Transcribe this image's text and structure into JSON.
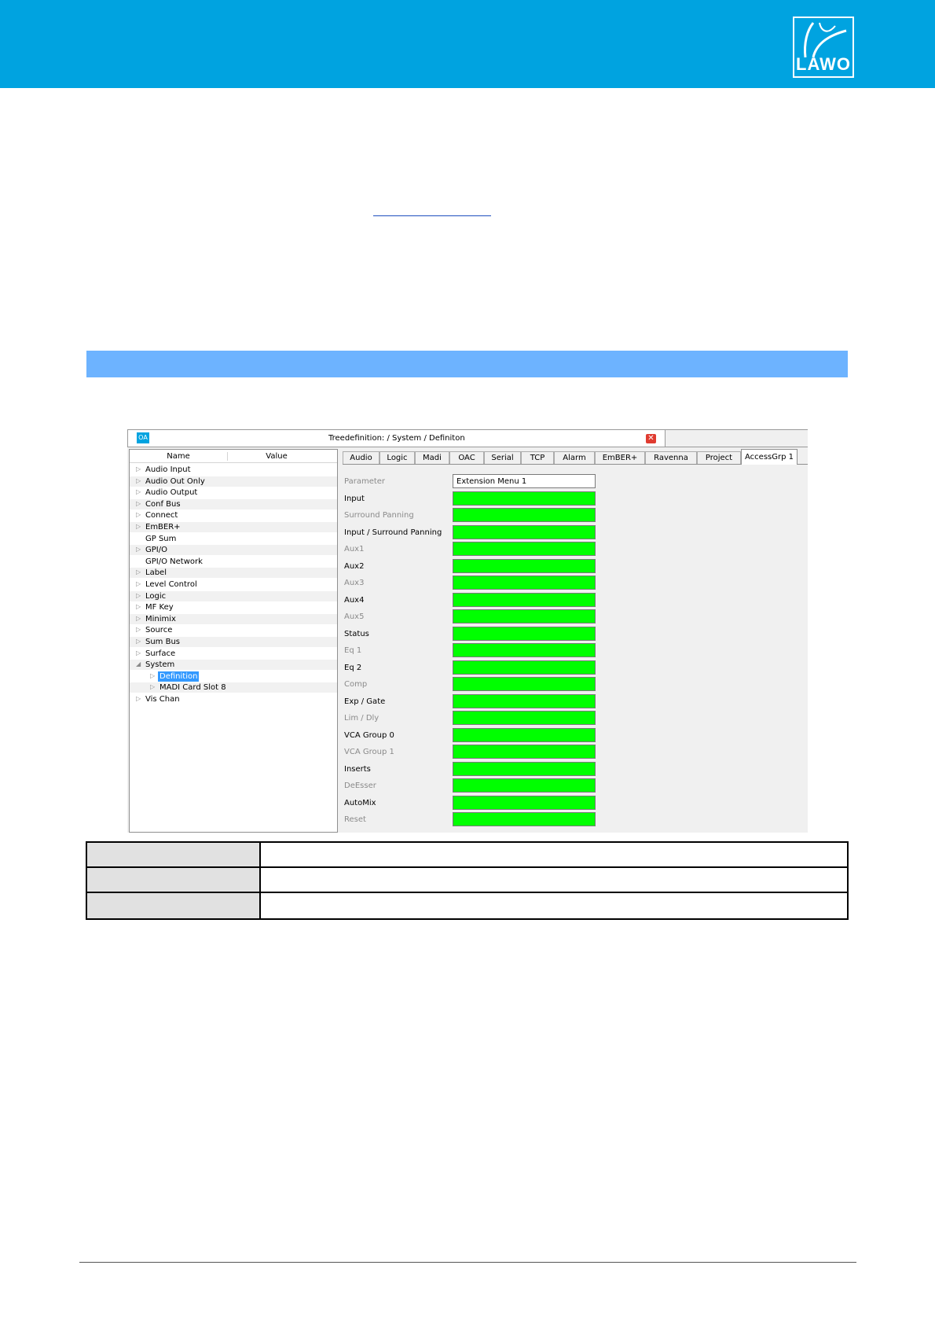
{
  "colors": {
    "header_blue": "#00a3e0",
    "section_bar": "#6db3ff",
    "selection": "#3399ff",
    "value_green": "#00ff00",
    "close_red": "#e03b30"
  },
  "header": {
    "logo_text": "LAWO"
  },
  "window": {
    "icon_label": "OA",
    "title": "Treedefinition:  / System / Definiton",
    "close_icon": "close-icon"
  },
  "tree": {
    "columns": [
      "Name",
      "Value"
    ],
    "items": [
      {
        "label": "Audio Input",
        "arrow": "▷",
        "indent": 0,
        "alt": false,
        "selected": false
      },
      {
        "label": "Audio Out Only",
        "arrow": "▷",
        "indent": 0,
        "alt": true,
        "selected": false
      },
      {
        "label": "Audio Output",
        "arrow": "▷",
        "indent": 0,
        "alt": false,
        "selected": false
      },
      {
        "label": "Conf Bus",
        "arrow": "▷",
        "indent": 0,
        "alt": true,
        "selected": false
      },
      {
        "label": "Connect",
        "arrow": "▷",
        "indent": 0,
        "alt": false,
        "selected": false
      },
      {
        "label": "EmBER+",
        "arrow": "▷",
        "indent": 0,
        "alt": true,
        "selected": false
      },
      {
        "label": "GP Sum",
        "arrow": "",
        "indent": 0,
        "alt": false,
        "selected": false
      },
      {
        "label": "GPI/O",
        "arrow": "▷",
        "indent": 0,
        "alt": true,
        "selected": false
      },
      {
        "label": "GPI/O Network",
        "arrow": "",
        "indent": 0,
        "alt": false,
        "selected": false
      },
      {
        "label": "Label",
        "arrow": "▷",
        "indent": 0,
        "alt": true,
        "selected": false
      },
      {
        "label": "Level Control",
        "arrow": "▷",
        "indent": 0,
        "alt": false,
        "selected": false
      },
      {
        "label": "Logic",
        "arrow": "▷",
        "indent": 0,
        "alt": true,
        "selected": false
      },
      {
        "label": "MF Key",
        "arrow": "▷",
        "indent": 0,
        "alt": false,
        "selected": false
      },
      {
        "label": "Minimix",
        "arrow": "▷",
        "indent": 0,
        "alt": true,
        "selected": false
      },
      {
        "label": "Source",
        "arrow": "▷",
        "indent": 0,
        "alt": false,
        "selected": false
      },
      {
        "label": "Sum Bus",
        "arrow": "▷",
        "indent": 0,
        "alt": true,
        "selected": false
      },
      {
        "label": "Surface",
        "arrow": "▷",
        "indent": 0,
        "alt": false,
        "selected": false
      },
      {
        "label": "System",
        "arrow": "◢",
        "indent": 0,
        "alt": true,
        "selected": false
      },
      {
        "label": "Definition",
        "arrow": "▷",
        "indent": 1,
        "alt": false,
        "selected": true
      },
      {
        "label": "MADI Card Slot 8",
        "arrow": "▷",
        "indent": 1,
        "alt": true,
        "selected": false
      },
      {
        "label": "Vis Chan",
        "arrow": "▷",
        "indent": 0,
        "alt": false,
        "selected": false
      }
    ]
  },
  "tabs": [
    {
      "label": "Audio",
      "active": false
    },
    {
      "label": "Logic",
      "active": false
    },
    {
      "label": "Madi",
      "active": false
    },
    {
      "label": "OAC",
      "active": false
    },
    {
      "label": "Serial",
      "active": false
    },
    {
      "label": "TCP",
      "active": false
    },
    {
      "label": "Alarm",
      "active": false
    },
    {
      "label": "EmBER+",
      "active": false
    },
    {
      "label": "Ravenna",
      "active": false
    },
    {
      "label": "Project",
      "active": false
    },
    {
      "label": "AccessGrp 1",
      "active": true
    }
  ],
  "params": [
    {
      "label": "Parameter",
      "dim": true,
      "value": "Extension Menu 1"
    },
    {
      "label": "Input",
      "dim": false,
      "value": ""
    },
    {
      "label": "Surround Panning",
      "dim": true,
      "value": ""
    },
    {
      "label": "Input / Surround Panning",
      "dim": false,
      "value": ""
    },
    {
      "label": "Aux1",
      "dim": true,
      "value": ""
    },
    {
      "label": "Aux2",
      "dim": false,
      "value": ""
    },
    {
      "label": "Aux3",
      "dim": true,
      "value": ""
    },
    {
      "label": "Aux4",
      "dim": false,
      "value": ""
    },
    {
      "label": "Aux5",
      "dim": true,
      "value": ""
    },
    {
      "label": "Status",
      "dim": false,
      "value": ""
    },
    {
      "label": "Eq 1",
      "dim": true,
      "value": ""
    },
    {
      "label": "Eq 2",
      "dim": false,
      "value": ""
    },
    {
      "label": "Comp",
      "dim": true,
      "value": ""
    },
    {
      "label": "Exp / Gate",
      "dim": false,
      "value": ""
    },
    {
      "label": "Lim / Dly",
      "dim": true,
      "value": ""
    },
    {
      "label": "VCA Group 0",
      "dim": false,
      "value": ""
    },
    {
      "label": "VCA Group 1",
      "dim": true,
      "value": ""
    },
    {
      "label": "Inserts",
      "dim": false,
      "value": ""
    },
    {
      "label": "DeEsser",
      "dim": true,
      "value": ""
    },
    {
      "label": "AutoMix",
      "dim": false,
      "value": ""
    },
    {
      "label": "Reset",
      "dim": true,
      "value": ""
    }
  ]
}
